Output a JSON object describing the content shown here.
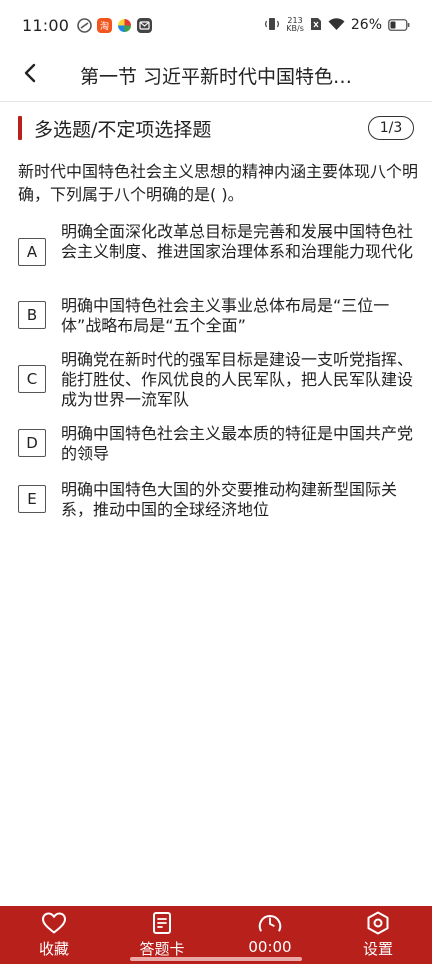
{
  "status": {
    "time": "11:00",
    "net_speed_value": "213",
    "net_speed_unit": "KB/s",
    "battery": "26%"
  },
  "header": {
    "title": "第一节 习近平新时代中国特色…"
  },
  "question_type": {
    "label": "多选题/不定项选择题",
    "progress": "1/3"
  },
  "question": {
    "text": "新时代中国特色社会主义思想的精神内涵主要体现八个明确，下列属于八个明确的是( )。"
  },
  "options": [
    {
      "letter": "A",
      "text": "明确全面深化改革总目标是完善和发展中国特色社会主义制度、推进国家治理体系和治理能力现代化"
    },
    {
      "letter": "B",
      "text": "明确中国特色社会主义事业总体布局是“三位一体”战略布局是“五个全面”"
    },
    {
      "letter": "C",
      "text": "明确党在新时代的强军目标是建设一支听党指挥、能打胜仗、作风优良的人民军队，把人民军队建设成为世界一流军队"
    },
    {
      "letter": "D",
      "text": "明确中国特色社会主义最本质的特征是中国共产党的领导"
    },
    {
      "letter": "E",
      "text": "明确中国特色大国的外交要推动构建新型国际关系，推动中国的全球经济地位"
    }
  ],
  "bottom_tabs": {
    "favorite": "收藏",
    "answer_card": "答题卡",
    "timer": "00:00",
    "settings": "设置"
  },
  "colors": {
    "accent": "#b8201c"
  }
}
